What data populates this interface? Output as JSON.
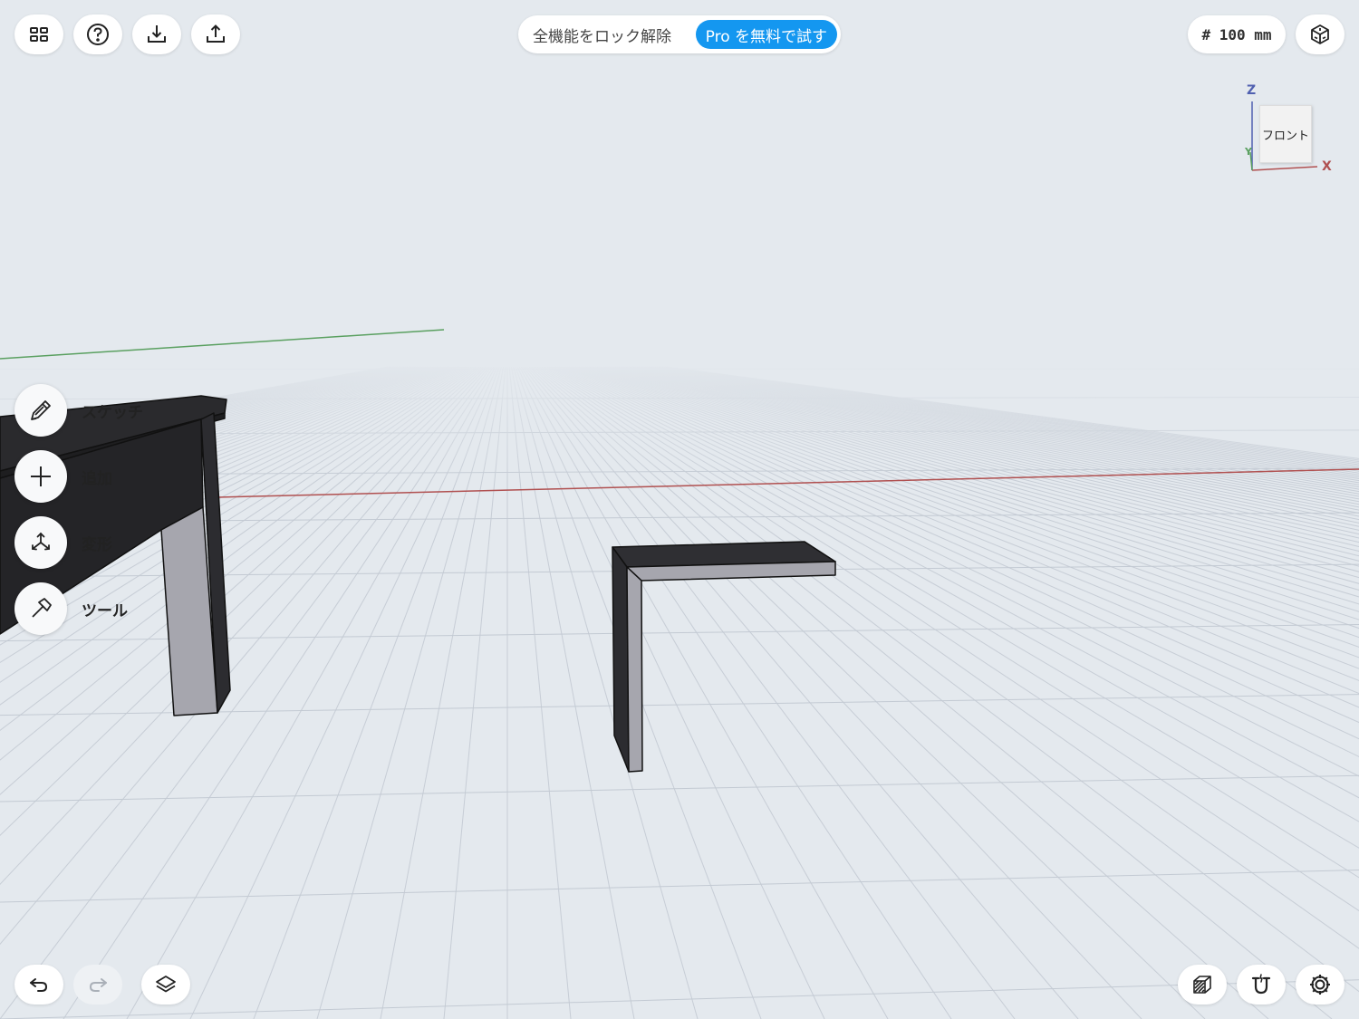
{
  "toolbar": {
    "menu_icon": "grid-menu-icon",
    "help_icon": "help-icon",
    "import_icon": "import-icon",
    "export_icon": "export-icon"
  },
  "banner": {
    "text": "全機能をロック解除",
    "pro_label": "Pro を無料で試す"
  },
  "grid": {
    "label": "# 100 mm"
  },
  "view_cube": {
    "face_label": "フロント",
    "axis_z": "Z",
    "axis_x": "X",
    "axis_y": "Y"
  },
  "side_menu": {
    "items": [
      {
        "label": "スケッチ",
        "icon": "pencil-icon"
      },
      {
        "label": "追加",
        "icon": "plus-icon"
      },
      {
        "label": "変形",
        "icon": "transform-arrows-icon"
      },
      {
        "label": "ツール",
        "icon": "hammer-icon"
      }
    ]
  },
  "bottom_bar": {
    "undo_icon": "undo-icon",
    "redo_icon": "redo-icon",
    "layers_icon": "layers-icon",
    "section_icon": "section-view-icon",
    "snap_icon": "magnet-snap-icon",
    "settings_icon": "gear-icon"
  },
  "colors": {
    "background": "#e4e9ee",
    "accent": "#1497f0",
    "x_axis": "#b05050",
    "y_axis": "#5aa060",
    "z_axis": "#5060b0",
    "model_dark": "#2a2a2d",
    "model_light": "#a6a6ae"
  }
}
